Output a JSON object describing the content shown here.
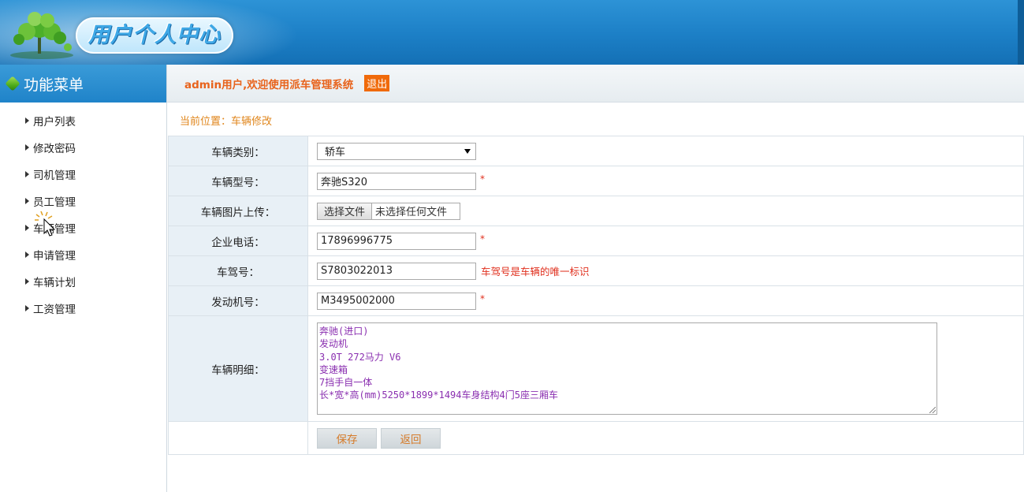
{
  "header": {
    "title": "用户个人中心",
    "logo_icon": "tree-logo-icon"
  },
  "sidebar": {
    "title": "功能菜单",
    "items": [
      {
        "label": "用户列表"
      },
      {
        "label": "修改密码"
      },
      {
        "label": "司机管理"
      },
      {
        "label": "员工管理"
      },
      {
        "label": "车辆管理"
      },
      {
        "label": "申请管理"
      },
      {
        "label": "车辆计划"
      },
      {
        "label": "工资管理"
      }
    ]
  },
  "topbar": {
    "welcome": "admin用户,欢迎使用派车管理系统",
    "logout": "退出"
  },
  "breadcrumb": "当前位置：车辆修改",
  "form": {
    "category": {
      "label": "车辆类别：",
      "value": "轿车"
    },
    "model": {
      "label": "车辆型号：",
      "value": "奔驰S320",
      "required": "*"
    },
    "image": {
      "label": "车辆图片上传：",
      "button": "选择文件",
      "status": "未选择任何文件"
    },
    "phone": {
      "label": "企业电话：",
      "value": "17896996775",
      "required": "*"
    },
    "plate": {
      "label": "车驾号：",
      "value": "S7803022013",
      "hint": "车驾号是车辆的唯一标识"
    },
    "engine": {
      "label": "发动机号：",
      "value": "M3495002000",
      "required": "*"
    },
    "detail": {
      "label": "车辆明细：",
      "lines": [
        "奔驰(进口)",
        "发动机",
        "3.0T 272马力 V6",
        "变速箱",
        "7挡手自一体",
        "长*宽*高(mm)5250*1899*1494车身结构4门5座三厢车"
      ]
    },
    "save": "保存",
    "back": "返回"
  },
  "colors": {
    "header_blue": "#1c7fc6",
    "accent_orange": "#e8631c",
    "required_red": "#e0301e",
    "label_bg": "#e8f0f6",
    "textarea_text": "#8a2fb0"
  }
}
